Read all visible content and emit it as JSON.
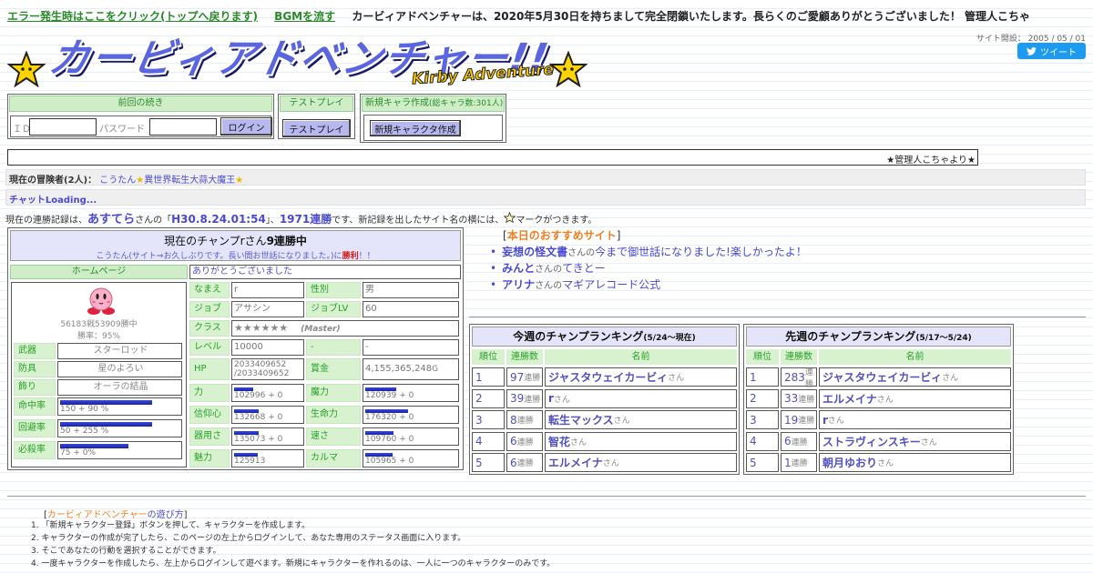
{
  "topbar": {
    "error_link": "エラー発生時はここをクリック(トップへ戻ります)",
    "bgm_link": "BGMを流す",
    "notice": "カービィアドベンチャーは、2020年5月30日を持ちまして完全閉鎖いたします。長らくのご愛顧ありがとうございました！ 管理人こちゃ"
  },
  "header": {
    "site_open": "サイト開設： 2005 / 05 / 01",
    "tweet": "ツイート",
    "logo_text": "カービィアドベンチャー!!",
    "logo_sub": "Kirby Adventure"
  },
  "login": {
    "title": "前回の続き",
    "id_label": "ＩＤ",
    "pw_label": "パスワード",
    "button": "ログイン"
  },
  "test": {
    "title": "テストプレイ",
    "button": "テストプレイ"
  },
  "newchar": {
    "title": "新規キャラ作成",
    "count": "(総キャラ数:301人)",
    "button": "新規キャラクタ作成"
  },
  "admin_bar": "★管理人こちゃより★",
  "adventurers": {
    "label": "現在の冒険者(2人)：",
    "names": [
      "こうたん",
      "異世界転生大蒜大魔王"
    ]
  },
  "chat": "チャットLoading...",
  "record": {
    "pre": "現在の連勝記録は、",
    "name": "あすてら",
    "san": "さんの「",
    "date": "H30.8.24.01:54",
    "mid": "」、",
    "wins": "1971連勝",
    "post": "です、新記録を出したサイト名の横には、",
    "post2": "マークがつきます。"
  },
  "champ": {
    "title_pre": "現在のチャンプ",
    "title_name": "r",
    "title_mid": "さん",
    "title_wins": "9連勝中",
    "comment_pre": "こうたん(サイト⇒お久しぶりです。長い間お世話になりました。)に",
    "comment_win": "勝利",
    "comment_post": "！！",
    "homepage": "ホームページ",
    "message": "ありがとうございました",
    "record": "56183戦53909勝中",
    "rate": "勝率：95%",
    "equip": [
      {
        "key": "武器",
        "value": "スターロッド"
      },
      {
        "key": "防具",
        "value": "星のよろい"
      },
      {
        "key": "飾り",
        "value": "オーラの結晶"
      }
    ],
    "rates": [
      {
        "key": "命中率",
        "value": "150 + 90 %",
        "fill": 0.78
      },
      {
        "key": "回避率",
        "value": "50 + 255 %",
        "fill": 0.78
      },
      {
        "key": "必殺率",
        "value": "75 + 0%",
        "fill": 0.58
      }
    ],
    "info": {
      "name_k": "なまえ",
      "name_v": "r",
      "sex_k": "性別",
      "sex_v": "男",
      "job_k": "ジョブ",
      "job_v": "アサシン",
      "joblv_k": "ジョブLV",
      "joblv_v": "60",
      "class_k": "クラス",
      "class_v": "★★★★★★",
      "class_extra": "(Master)",
      "level_k": "レベル",
      "level_v": "10000",
      "dash_k": "-",
      "dash_v": "-",
      "hp_k": "HP",
      "hp_v1": "2033409652",
      "hp_v2": "/2033409652",
      "gold_k": "賞金",
      "gold_v": "4,155,365,248",
      "gold_unit": "G"
    },
    "stats": [
      {
        "k": "力",
        "v": "102996 + 0",
        "fill": 0.28,
        "k2": "魔力",
        "v2": "120939 + 0",
        "fill2": 0.33
      },
      {
        "k": "信仰心",
        "v": "132668 + 0",
        "fill": 0.36,
        "k2": "生命力",
        "v2": "176320 + 0",
        "fill2": 0.46
      },
      {
        "k": "器用さ",
        "v": "135073 + 0",
        "fill": 0.36,
        "k2": "速さ",
        "v2": "109760 + 0",
        "fill2": 0.3
      },
      {
        "k": "魅力",
        "v": "125913",
        "fill": 0.34,
        "k2": "カルマ",
        "v2": "105965 + 0",
        "fill2": 0.29
      }
    ]
  },
  "recommend": {
    "title": "本日のおすすめサイト",
    "items": [
      {
        "site": "妄想の怪文書",
        "by": "さんの",
        "desc": "今まで御世話になりました!楽しかったよ！"
      },
      {
        "site": "みんと",
        "by": "さんの",
        "desc": "てきとー"
      },
      {
        "site": "アリナ",
        "by": "さんの",
        "desc": "マギアレコード公式"
      }
    ]
  },
  "ranking_this": {
    "title": "今週のチャンプランキング",
    "period": "(5/24～現在)",
    "headers": [
      "順位",
      "連勝数",
      "名前"
    ],
    "rows": [
      {
        "rank": "1",
        "wins": "97",
        "name": "ジャスタウェイカービィ"
      },
      {
        "rank": "2",
        "wins": "39",
        "name": "r"
      },
      {
        "rank": "3",
        "wins": "8",
        "name": "転生マックス"
      },
      {
        "rank": "4",
        "wins": "6",
        "name": "智花"
      },
      {
        "rank": "5",
        "wins": "6",
        "name": "エルメイナ"
      }
    ]
  },
  "ranking_last": {
    "title": "先週のチャンプランキング",
    "period": "(5/17～5/24)",
    "headers": [
      "順位",
      "連勝数",
      "名前"
    ],
    "rows": [
      {
        "rank": "1",
        "wins": "283",
        "name": "ジャスタウェイカービィ"
      },
      {
        "rank": "2",
        "wins": "33",
        "name": "エルメイナ"
      },
      {
        "rank": "3",
        "wins": "19",
        "name": "r"
      },
      {
        "rank": "4",
        "wins": "6",
        "name": "ストラヴィンスキー"
      },
      {
        "rank": "5",
        "wins": "1",
        "name": "朝月ゆおり"
      }
    ]
  },
  "win_suffix": "連勝",
  "san_suffix": "さん",
  "howto": {
    "title_pre": "カービィアドベンチャー",
    "title_post": "の遊び方",
    "steps": [
      "「新規キャラクター登録」ボタンを押して、キャラクターを作成します。",
      "キャラクターの作成が完了したら、このページの左上からログインして、あなた専用のステータス画面に入ります。",
      "そこであなたの行動を選択することができます。",
      "一度キャラクターを作成したら、左上からログインして遊べます。新規にキャラクターを作れるのは、一人に一つのキャラクターのみです。"
    ]
  },
  "colors": {
    "accent": "#4a4ad0",
    "green": "#28a028",
    "bar": "#1a22a0",
    "tweet": "#1d9bf0"
  }
}
